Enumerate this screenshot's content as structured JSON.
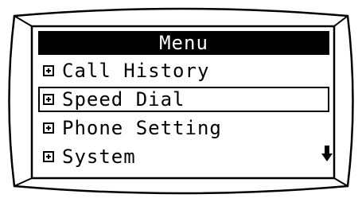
{
  "menu": {
    "title": "Menu",
    "items": [
      {
        "label": "Call History",
        "selected": false
      },
      {
        "label": "Speed Dial",
        "selected": true
      },
      {
        "label": "Phone Setting",
        "selected": false
      },
      {
        "label": "System",
        "selected": false
      }
    ]
  },
  "icons": {
    "item_marker": "expand-plus-icon",
    "scroll_indicator": "arrow-down-icon"
  }
}
